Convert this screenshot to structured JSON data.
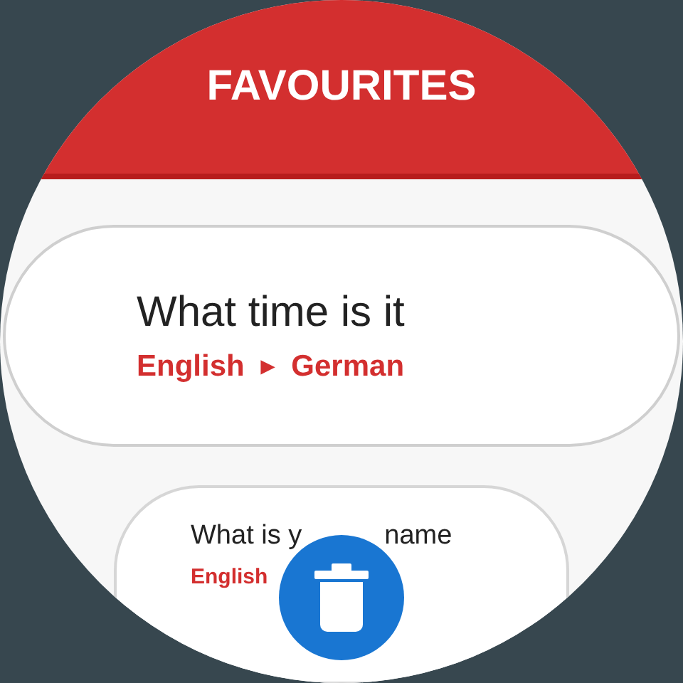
{
  "header": {
    "title": "FAVOURITES"
  },
  "favourites": [
    {
      "phrase": "What time is it",
      "from": "English",
      "separator": "►",
      "to": "German"
    },
    {
      "phrase_parts": [
        "What is y",
        "name"
      ],
      "from": "English"
    }
  ],
  "delete_button": {
    "kind": "trash"
  }
}
